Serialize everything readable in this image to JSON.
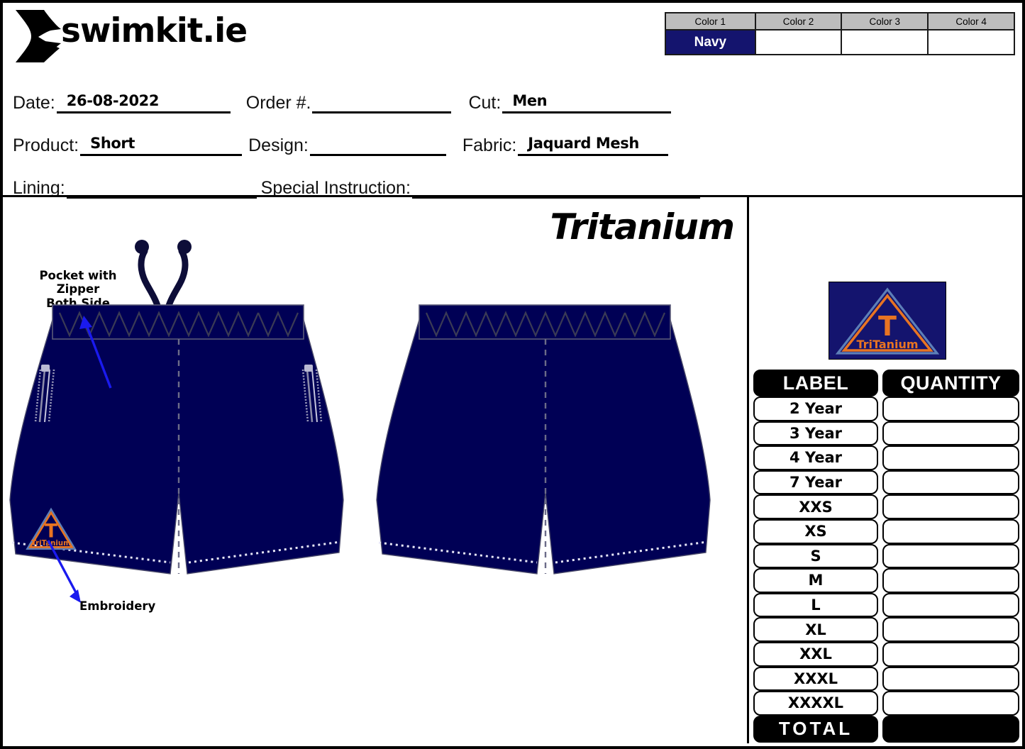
{
  "brand": {
    "name": "swimkit.ie",
    "logo_icon": "swimmer-arrow-logo"
  },
  "color_table": {
    "headers": [
      "Color 1",
      "Color 2",
      "Color 3",
      "Color 4"
    ],
    "values": [
      "Navy",
      "",
      "",
      ""
    ],
    "navy_hex": "#14146e",
    "header_bg_hex": "#bdbdbd"
  },
  "form": {
    "rows": [
      [
        {
          "label": "Date:",
          "value": "26-08-2022"
        },
        {
          "label": "Order #.",
          "value": ""
        },
        {
          "label": "Cut:",
          "value": "Men"
        }
      ],
      [
        {
          "label": "Product:",
          "value": "Short"
        },
        {
          "label": "Design:",
          "value": ""
        },
        {
          "label": "Fabric:",
          "value": "Jaquard Mesh"
        }
      ],
      [
        {
          "label": "Lining:",
          "value": ""
        },
        {
          "label": "Special Instruction:",
          "value": ""
        }
      ]
    ],
    "date_label": "Date:",
    "date_value": "26-08-2022",
    "order_label": "Order #.",
    "order_value": "",
    "cut_label": "Cut:",
    "cut_value": "Men",
    "product_label": "Product:",
    "product_value": "Short",
    "design_label": "Design:",
    "design_value": "",
    "fabric_label": "Fabric:",
    "fabric_value": "Jaquard Mesh",
    "lining_label": "Lining:",
    "lining_value": "",
    "special_label": "Special Instruction:",
    "special_value": ""
  },
  "design": {
    "title": "Tritanium",
    "garment_color_hex": "#000055",
    "annotations": {
      "pocket": "Pocket with\nZipper\nBoth Side",
      "pocket_line1": "Pocket with",
      "pocket_line2": "Zipper",
      "pocket_line3": "Both Side",
      "embroidery": "Embroidery",
      "arrow_color_hex": "#1a1aee"
    },
    "views": [
      "front",
      "back"
    ]
  },
  "logo_badge": {
    "brand_mark": "TriTanium",
    "letter": "T",
    "triangle_color_hex": "#e87422",
    "outline_color_hex": "#4a6fa8",
    "background_hex": "#14146e"
  },
  "size_table": {
    "headers": [
      "LABEL",
      "QUANTITY"
    ],
    "rows": [
      {
        "label": "2 Year",
        "quantity": ""
      },
      {
        "label": "3 Year",
        "quantity": ""
      },
      {
        "label": "4 Year",
        "quantity": ""
      },
      {
        "label": "7 Year",
        "quantity": ""
      },
      {
        "label": "XXS",
        "quantity": ""
      },
      {
        "label": "XS",
        "quantity": ""
      },
      {
        "label": "S",
        "quantity": ""
      },
      {
        "label": "M",
        "quantity": ""
      },
      {
        "label": "L",
        "quantity": ""
      },
      {
        "label": "XL",
        "quantity": ""
      },
      {
        "label": "XXL",
        "quantity": ""
      },
      {
        "label": "XXXL",
        "quantity": ""
      },
      {
        "label": "XXXXL",
        "quantity": ""
      }
    ],
    "total_label": "TOTAL",
    "total_value": ""
  }
}
